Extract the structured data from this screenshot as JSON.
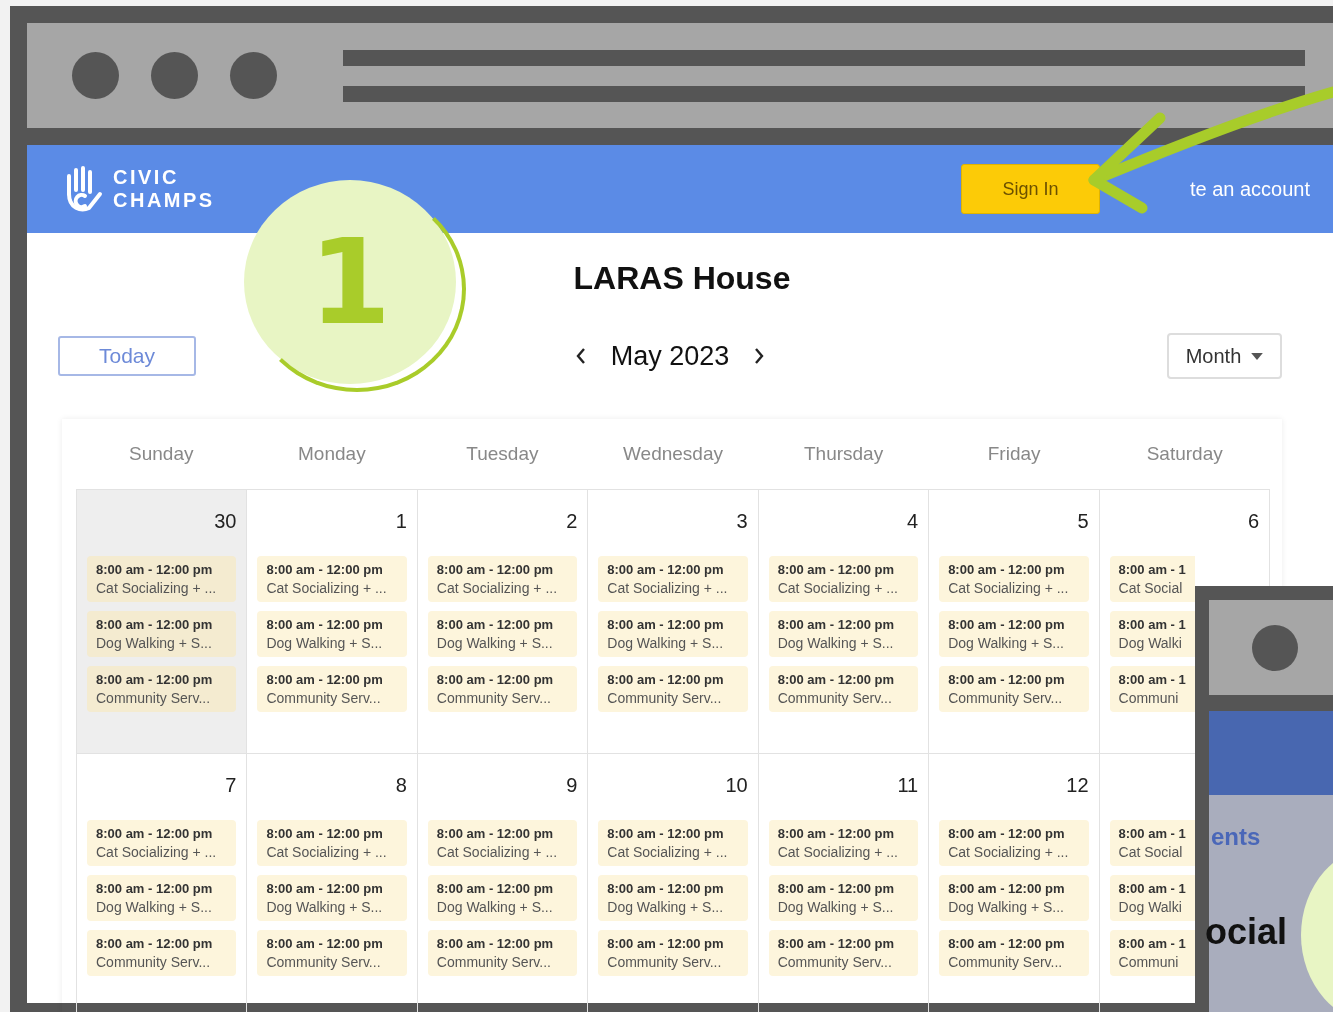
{
  "header": {
    "logo_lines": [
      "CIVIC",
      "CHAMPS"
    ],
    "sign_in": "Sign In",
    "create_account": "te an account"
  },
  "callout": {
    "number": "1"
  },
  "calendar": {
    "title": "LARAS House",
    "today": "Today",
    "month": "May 2023",
    "view": "Month",
    "weekdays": [
      "Sunday",
      "Monday",
      "Tuesday",
      "Wednesday",
      "Thursday",
      "Friday",
      "Saturday"
    ],
    "weeks": [
      {
        "days": [
          {
            "date": "30",
            "outside": true,
            "events": [
              {
                "time": "8:00 am - 12:00 pm",
                "title": "Cat Socializing + ..."
              },
              {
                "time": "8:00 am - 12:00 pm",
                "title": "Dog Walking + S..."
              },
              {
                "time": "8:00 am - 12:00 pm",
                "title": "Community Serv..."
              }
            ]
          },
          {
            "date": "1",
            "outside": false,
            "events": [
              {
                "time": "8:00 am - 12:00 pm",
                "title": "Cat Socializing + ..."
              },
              {
                "time": "8:00 am - 12:00 pm",
                "title": "Dog Walking + S..."
              },
              {
                "time": "8:00 am - 12:00 pm",
                "title": "Community Serv..."
              }
            ]
          },
          {
            "date": "2",
            "outside": false,
            "events": [
              {
                "time": "8:00 am - 12:00 pm",
                "title": "Cat Socializing + ..."
              },
              {
                "time": "8:00 am - 12:00 pm",
                "title": "Dog Walking + S..."
              },
              {
                "time": "8:00 am - 12:00 pm",
                "title": "Community Serv..."
              }
            ]
          },
          {
            "date": "3",
            "outside": false,
            "events": [
              {
                "time": "8:00 am - 12:00 pm",
                "title": "Cat Socializing + ..."
              },
              {
                "time": "8:00 am - 12:00 pm",
                "title": "Dog Walking + S..."
              },
              {
                "time": "8:00 am - 12:00 pm",
                "title": "Community Serv..."
              }
            ]
          },
          {
            "date": "4",
            "outside": false,
            "events": [
              {
                "time": "8:00 am - 12:00 pm",
                "title": "Cat Socializing + ..."
              },
              {
                "time": "8:00 am - 12:00 pm",
                "title": "Dog Walking + S..."
              },
              {
                "time": "8:00 am - 12:00 pm",
                "title": "Community Serv..."
              }
            ]
          },
          {
            "date": "5",
            "outside": false,
            "events": [
              {
                "time": "8:00 am - 12:00 pm",
                "title": "Cat Socializing + ..."
              },
              {
                "time": "8:00 am - 12:00 pm",
                "title": "Dog Walking + S..."
              },
              {
                "time": "8:00 am - 12:00 pm",
                "title": "Community Serv..."
              }
            ]
          },
          {
            "date": "6",
            "outside": false,
            "events": [
              {
                "time": "8:00 am - 1",
                "title": "Cat Social"
              },
              {
                "time": "8:00 am - 1",
                "title": "Dog Walki"
              },
              {
                "time": "8:00 am - 1",
                "title": "Communi"
              }
            ]
          }
        ]
      },
      {
        "days": [
          {
            "date": "7",
            "outside": false,
            "events": [
              {
                "time": "8:00 am - 12:00 pm",
                "title": "Cat Socializing + ..."
              },
              {
                "time": "8:00 am - 12:00 pm",
                "title": "Dog Walking + S..."
              },
              {
                "time": "8:00 am - 12:00 pm",
                "title": "Community Serv..."
              }
            ]
          },
          {
            "date": "8",
            "outside": false,
            "events": [
              {
                "time": "8:00 am - 12:00 pm",
                "title": "Cat Socializing + ..."
              },
              {
                "time": "8:00 am - 12:00 pm",
                "title": "Dog Walking + S..."
              },
              {
                "time": "8:00 am - 12:00 pm",
                "title": "Community Serv..."
              }
            ]
          },
          {
            "date": "9",
            "outside": false,
            "events": [
              {
                "time": "8:00 am - 12:00 pm",
                "title": "Cat Socializing + ..."
              },
              {
                "time": "8:00 am - 12:00 pm",
                "title": "Dog Walking + S..."
              },
              {
                "time": "8:00 am - 12:00 pm",
                "title": "Community Serv..."
              }
            ]
          },
          {
            "date": "10",
            "outside": false,
            "events": [
              {
                "time": "8:00 am - 12:00 pm",
                "title": "Cat Socializing + ..."
              },
              {
                "time": "8:00 am - 12:00 pm",
                "title": "Dog Walking + S..."
              },
              {
                "time": "8:00 am - 12:00 pm",
                "title": "Community Serv..."
              }
            ]
          },
          {
            "date": "11",
            "outside": false,
            "events": [
              {
                "time": "8:00 am - 12:00 pm",
                "title": "Cat Socializing + ..."
              },
              {
                "time": "8:00 am - 12:00 pm",
                "title": "Dog Walking + S..."
              },
              {
                "time": "8:00 am - 12:00 pm",
                "title": "Community Serv..."
              }
            ]
          },
          {
            "date": "12",
            "outside": false,
            "events": [
              {
                "time": "8:00 am - 12:00 pm",
                "title": "Cat Socializing + ..."
              },
              {
                "time": "8:00 am - 12:00 pm",
                "title": "Dog Walking + S..."
              },
              {
                "time": "8:00 am - 12:00 pm",
                "title": "Community Serv..."
              }
            ]
          },
          {
            "outside": false,
            "events": [
              {
                "time": "8:00 am - 1",
                "title": "Cat Social"
              },
              {
                "time": "8:00 am - 1",
                "title": "Dog Walki"
              },
              {
                "time": "8:00 am - 1",
                "title": "Communi"
              }
            ]
          }
        ]
      }
    ]
  },
  "overlay_window": {
    "link_text": "ents",
    "heading_text": "ocial"
  }
}
